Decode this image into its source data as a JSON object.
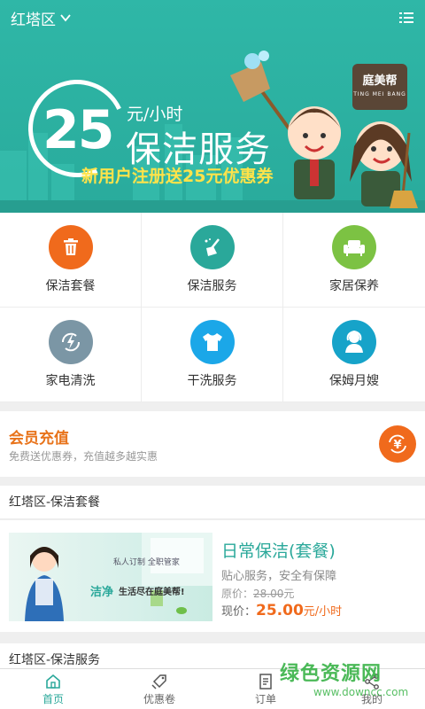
{
  "header": {
    "location": "红塔区",
    "menu_icon": "list-icon"
  },
  "banner": {
    "price": "25",
    "unit": "元/小时",
    "title": "保洁服务",
    "promo": "新用户注册送25元优惠券",
    "brand_cn": "庭美帮",
    "brand_en": "TING MEI BANG"
  },
  "services": [
    {
      "label": "保洁套餐",
      "icon": "trash-icon",
      "color": "#f06a1c"
    },
    {
      "label": "保洁服务",
      "icon": "broom-icon",
      "color": "#2aa89a"
    },
    {
      "label": "家居保养",
      "icon": "sofa-icon",
      "color": "#7cc243"
    },
    {
      "label": "家电清洗",
      "icon": "lightning-refresh-icon",
      "color": "#7b96a5"
    },
    {
      "label": "干洗服务",
      "icon": "tshirt-icon",
      "color": "#1ba7e8"
    },
    {
      "label": "保姆月嫂",
      "icon": "nanny-icon",
      "color": "#16a3c9"
    }
  ],
  "member": {
    "title": "会员充值",
    "subtitle": "免费送优惠券，充值越多越实惠",
    "icon": "yen-refresh-icon"
  },
  "section_package": {
    "header": "红塔区-保洁套餐",
    "item": {
      "title": "日常保洁(套餐)",
      "desc": "贴心服务，安全有保障",
      "orig_label": "原价：",
      "orig_price": "28.00",
      "orig_unit": "元",
      "now_label": "现价：",
      "now_price": "25.00",
      "now_unit": "元/小时",
      "image_text_1": "私人订制 全职管家",
      "image_text_2": "洁净",
      "image_text_3": "生活尽在庭美帮!"
    }
  },
  "section_service": {
    "header": "红塔区-保洁服务"
  },
  "bottom_nav": [
    {
      "label": "首页",
      "icon": "home-icon",
      "active": true
    },
    {
      "label": "优惠卷",
      "icon": "coupon-icon",
      "active": false
    },
    {
      "label": "订单",
      "icon": "order-icon",
      "active": false
    },
    {
      "label": "我的",
      "icon": "share-icon",
      "active": false
    }
  ],
  "watermark": {
    "cn": "绿色资源网",
    "url": "www.downcc.com"
  }
}
